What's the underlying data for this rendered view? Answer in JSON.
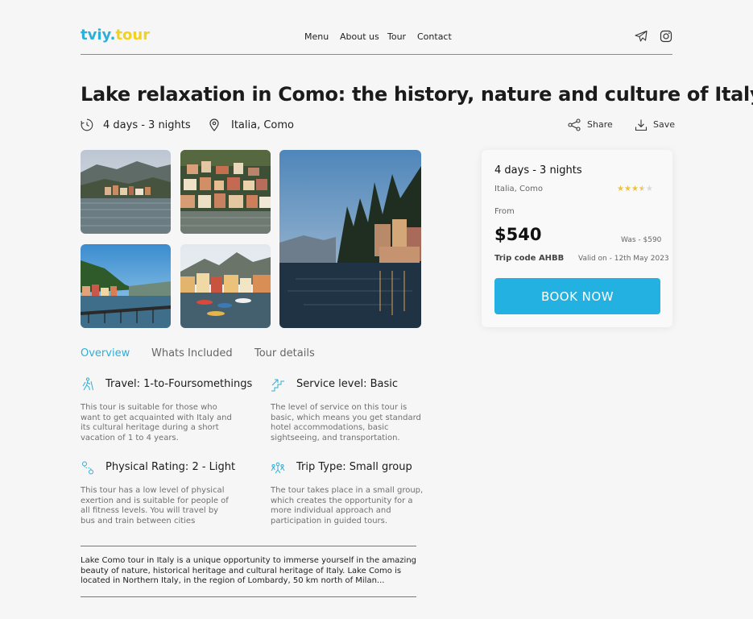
{
  "brand": {
    "part1": "tviy.",
    "part2": "tour",
    "color1": "#2bb0d8",
    "color2": "#f2d21e"
  },
  "nav": {
    "items": [
      "Menu",
      "About us",
      "Tour",
      "Contact"
    ]
  },
  "header_icons": [
    "telegram-icon",
    "instagram-icon"
  ],
  "page": {
    "title": "Lake relaxation in Como: the history, nature and culture of Italy",
    "duration": "4 days - 3 nights",
    "location": "Italia, Como",
    "share_label": "Share",
    "save_label": "Save"
  },
  "gallery": {
    "photos": [
      "lake-town-photo",
      "hillside-village-photo",
      "bridge-harbor-photo",
      "harbor-boats-photo",
      "evening-lakeside-photo"
    ]
  },
  "booking": {
    "duration": "4 days - 3 nights",
    "location": "Italia, Como",
    "rating": 3.5,
    "rating_max": 5,
    "from_label": "From",
    "price": "$540",
    "was_price": "Was - $590",
    "trip_code": "Trip code AHBB",
    "valid_on": "Valid on - 12th May 2023",
    "button_label": "BOOK NOW",
    "accent": "#22b1e0"
  },
  "tabs": [
    {
      "label": "Overview",
      "active": true
    },
    {
      "label": "Whats Included",
      "active": false
    },
    {
      "label": "Tour details",
      "active": false
    }
  ],
  "features": [
    {
      "icon": "hiker-icon",
      "title": "Travel: 1-to-Foursomethings",
      "desc": "This tour is suitable for those who want to get acquainted with Italy and its cultural heritage during a short vacation of 1 to 4 years."
    },
    {
      "icon": "stairs-icon",
      "title": "Service level: Basic",
      "desc": "The level of service on this tour is basic, which means you get standard hotel accommodations, basic sightseeing, and transportation."
    },
    {
      "icon": "route-icon",
      "title": "Physical Rating: 2 - Light",
      "desc": "This tour has a low level of physical exertion and is suitable for people of all fitness levels. You will travel by bus and train between cities"
    },
    {
      "icon": "group-icon",
      "title": "Trip Type: Small group",
      "desc": "The tour takes place in a small group, which creates the opportunity for a more individual approach and participation in guided tours."
    }
  ],
  "description": "Lake Como tour in Italy is a unique opportunity to immerse yourself in the amazing beauty of nature, historical heritage and cultural heritage of Italy. Lake Como is located in Northern Italy, in the region of Lombardy, 50 km north of Milan..."
}
